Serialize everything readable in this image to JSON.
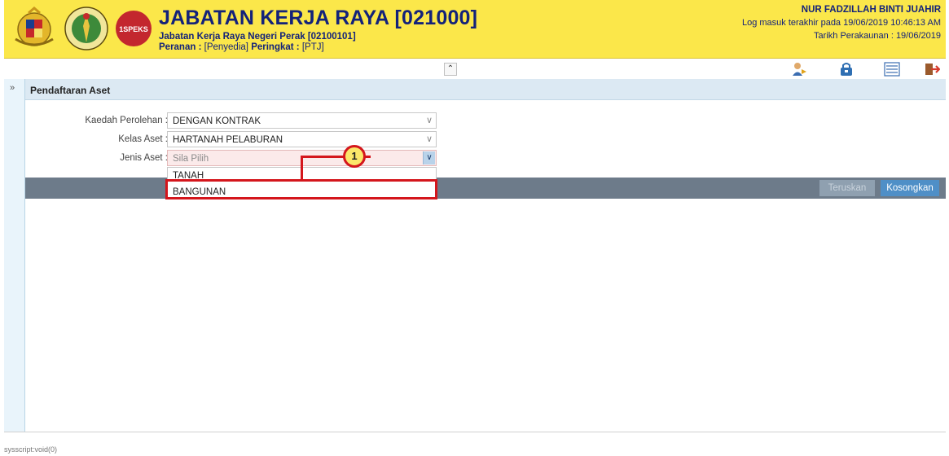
{
  "header": {
    "title": "JABATAN KERJA RAYA [021000]",
    "subtitle_1": "Jabatan Kerja Raya Negeri Perak [02100101]",
    "role_label": "Peranan :",
    "role_value": "[Penyedia]",
    "level_label": "Peringkat :",
    "level_value": "[PTJ]",
    "user_name": "NUR FADZILLAH BINTI JUAHIR",
    "login_info": "Log masuk terakhir pada 19/06/2019 10:46:13 AM",
    "accounting_date": "Tarikh Perakaunan : 19/06/2019",
    "logo_3_text": "1SPEKS"
  },
  "toolbar": {
    "collapse_icon": "double-chevron-up-icon",
    "icons": [
      "user-switch-icon",
      "lock-icon",
      "list-view-icon",
      "logout-icon"
    ]
  },
  "rail": {
    "arrow": "»"
  },
  "panel": {
    "title": "Pendaftaran Aset"
  },
  "form": {
    "kaedah_label": "Kaedah Perolehan :",
    "kaedah_value": "DENGAN KONTRAK",
    "kelas_label": "Kelas Aset :",
    "kelas_value": "HARTANAH PELABURAN",
    "jenis_label": "Jenis Aset :",
    "jenis_placeholder": "Sila Pilih",
    "jenis_options": [
      "TANAH",
      "BANGUNAN"
    ]
  },
  "callout": {
    "number": "1"
  },
  "actions": {
    "teruskan": "Teruskan",
    "kosongkan": "Kosongkan"
  },
  "status": {
    "text": "sysscript:void(0)"
  },
  "colors": {
    "header_bg": "#fbe74a",
    "title_text": "#13227a",
    "highlight_red": "#d4161c",
    "action_bar": "#6d7b8a",
    "primary_button": "#4f8fc7"
  }
}
